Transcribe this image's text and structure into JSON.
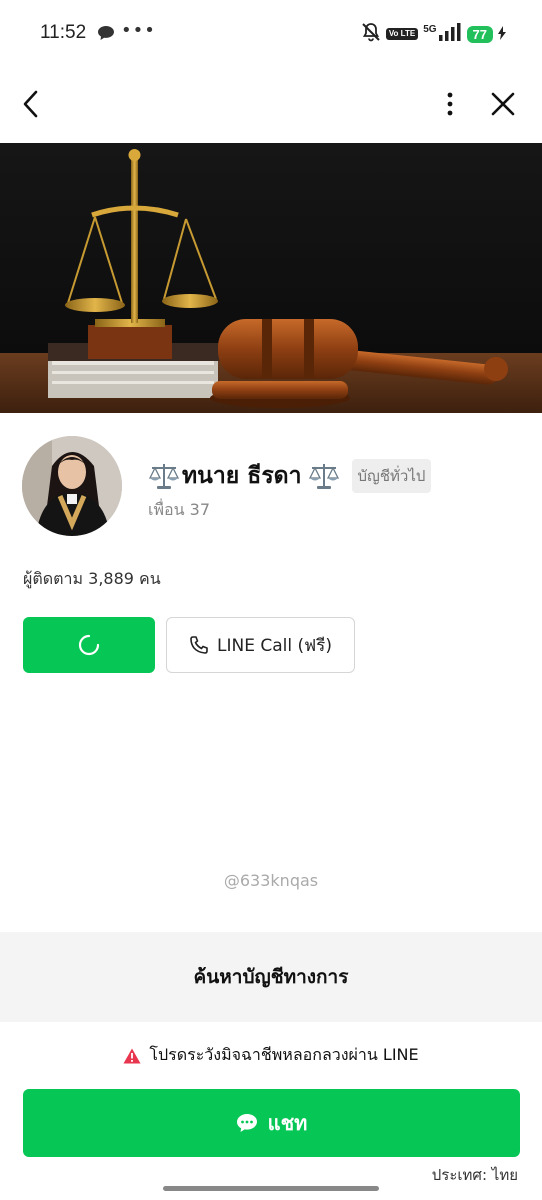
{
  "status_bar": {
    "time": "11:52",
    "dots": "•••",
    "volte": "Vo LTE",
    "network": "5G",
    "battery": "77"
  },
  "nav": {
    "back_icon": "chevron-left-icon",
    "more_icon": "more-vertical-icon",
    "close_icon": "close-icon"
  },
  "cover": {
    "image": "gavel-and-scales-photo"
  },
  "profile": {
    "name": "ทนาย ธีรดา",
    "name_emoji": "⚖️",
    "account_type": "บัญชีทั่วไป",
    "friends": "เพื่อน 37",
    "followers": "ผู้ติดตาม 3,889 คน"
  },
  "actions": {
    "add_button_state": "loading",
    "call_label": "LINE Call (ฟรี)",
    "call_icon": "phone-icon"
  },
  "line_id": "@633knqas",
  "search_official": "ค้นหาบัญชีทางการ",
  "warning": "โปรดระวังมิจฉาชีพหลอกลวงผ่าน LINE",
  "chat_button_label": "แชท",
  "country": "ประเทศ: ไทย",
  "colors": {
    "line_green": "#06c755",
    "warning_red": "#e8364f",
    "muted_gray": "#888888"
  }
}
